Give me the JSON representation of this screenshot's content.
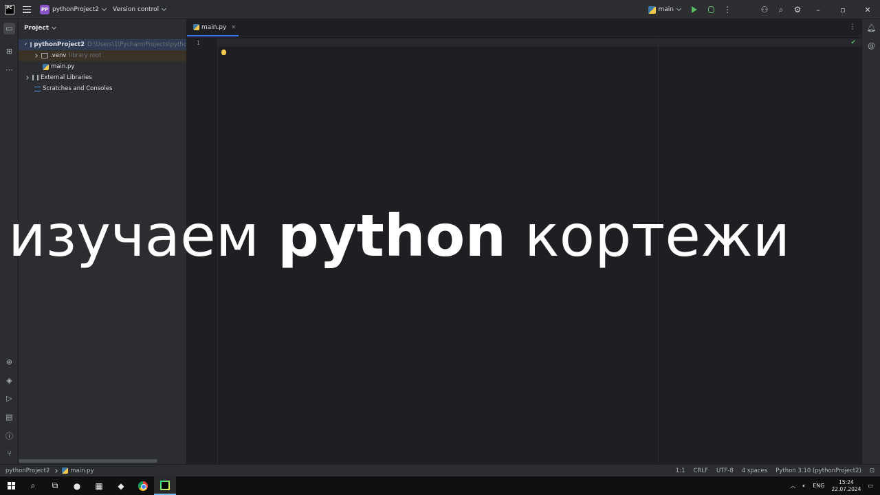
{
  "titlebar": {
    "logo_text": "PC",
    "project_badge": "PP",
    "project_name": "pythonProject2",
    "vcs_label": "Version control",
    "run_config": "main"
  },
  "project_panel": {
    "header": "Project",
    "tree": [
      {
        "label": "pythonProject2",
        "hint": "D:\\Users\\1\\PycharmProjects\\pytho"
      },
      {
        "label": ".venv",
        "hint": "library root"
      },
      {
        "label": "main.py",
        "hint": ""
      },
      {
        "label": "External Libraries",
        "hint": ""
      },
      {
        "label": "Scratches and Consoles",
        "hint": ""
      }
    ]
  },
  "editor": {
    "tab_label": "main.py",
    "line_number": "1"
  },
  "statusbar": {
    "breadcrumb_project": "pythonProject2",
    "breadcrumb_file": "main.py",
    "position": "1:1",
    "line_ending": "CRLF",
    "encoding": "UTF-8",
    "indent": "4 spaces",
    "interpreter": "Python 3.10 (pythonProject2)"
  },
  "taskbar": {
    "language": "ENG",
    "time": "15:24",
    "date": "22.07.2024"
  },
  "overlay": {
    "word1": "изучаем",
    "word2": "python",
    "word3": "кортежи"
  }
}
